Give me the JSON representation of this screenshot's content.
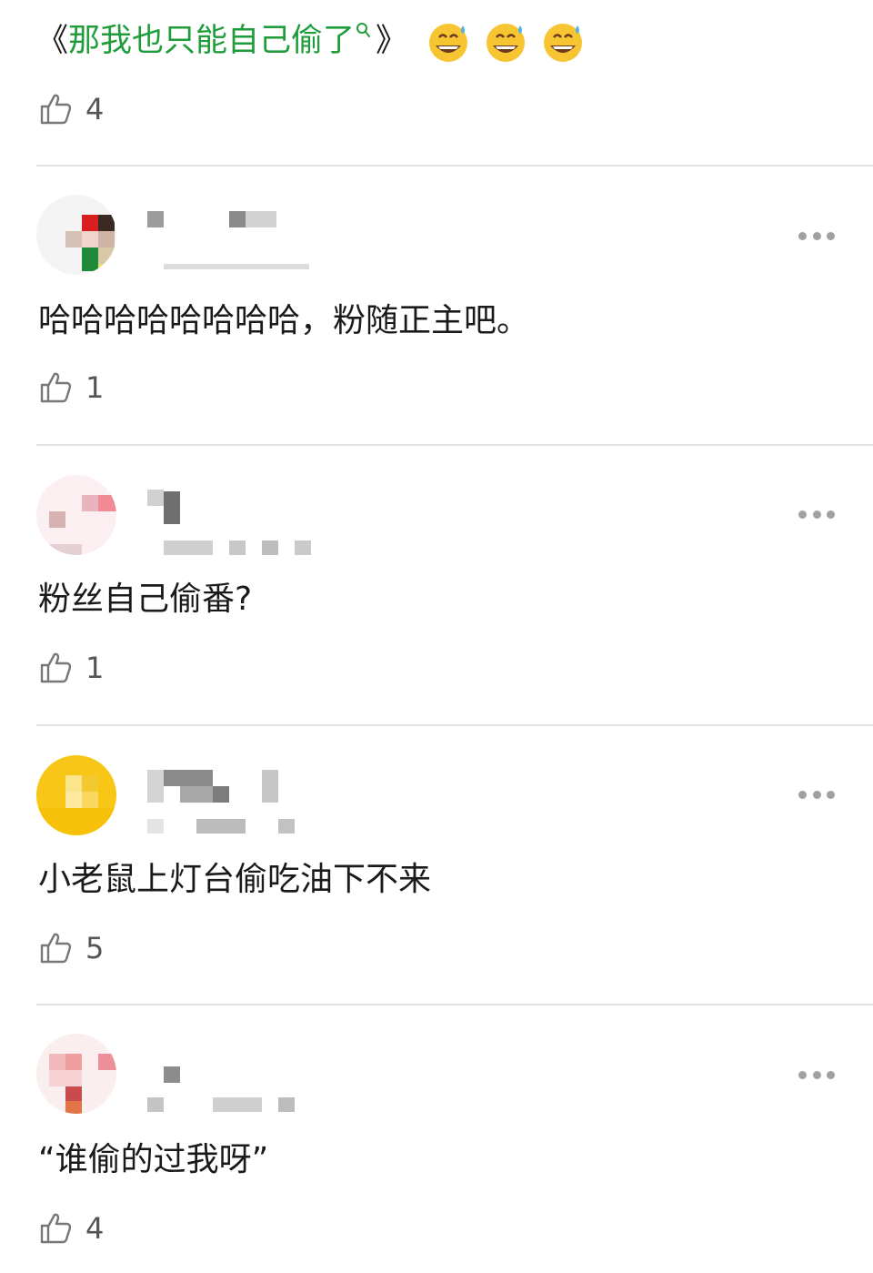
{
  "top_comment": {
    "open_bracket": "《",
    "topic_text": "那我也只能自己偷了",
    "close_bracket": "》",
    "emojis": [
      "grinning-sweat-emoji",
      "grinning-sweat-emoji",
      "grinning-sweat-emoji"
    ],
    "likes": "4"
  },
  "comments": [
    {
      "text": "哈哈哈哈哈哈哈哈，粉随正主吧。",
      "likes": "1"
    },
    {
      "text": "粉丝自己偷番?",
      "likes": "1"
    },
    {
      "text": "小老鼠上灯台偷吃油下不来",
      "likes": "5"
    },
    {
      "text": "“谁偷的过我呀”",
      "likes": "4"
    }
  ],
  "colors": {
    "topic_link": "#1f9d3a",
    "divider": "#e3e3e3",
    "like_icon": "#777777",
    "more_dots": "#a0a0a0"
  },
  "icons": {
    "like": "thumbs-up-icon",
    "more": "more-dots-icon",
    "topic_search": "search-icon"
  }
}
